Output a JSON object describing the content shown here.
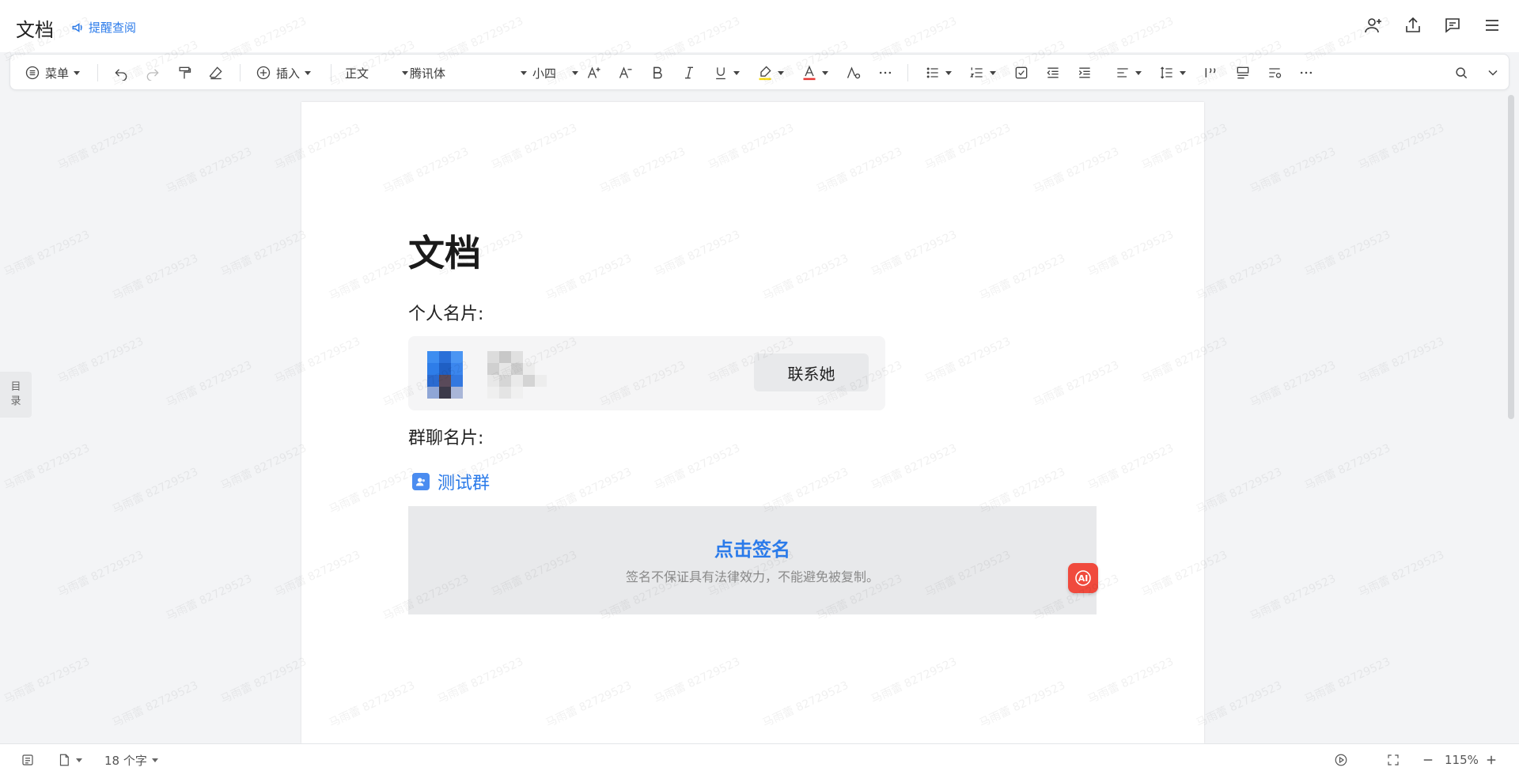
{
  "header": {
    "title": "文档",
    "remind_label": "提醒查阅"
  },
  "toolbar": {
    "menu_label": "菜单",
    "insert_label": "插入",
    "style_value": "正文",
    "font_value": "腾讯体",
    "size_value": "小四"
  },
  "toc": {
    "label_1": "目",
    "label_2": "录"
  },
  "document": {
    "heading": "文档",
    "personal_card_label": "个人名片:",
    "contact_button": "联系她",
    "group_card_label": "群聊名片:",
    "group_name": "测试群",
    "sign_title": "点击签名",
    "sign_subtitle": "签名不保证具有法律效力，不能避免被复制。"
  },
  "ai_button": {
    "label": "AI"
  },
  "statusbar": {
    "word_count": "18 个字",
    "zoom": "115%"
  },
  "colors": {
    "accent": "#2b7bea",
    "highlight_bar": "#f5d915",
    "font_color_bar": "#e53935",
    "ai_button": "#f04a3d"
  },
  "watermark": {
    "text": "马雨蕾 82729523"
  }
}
